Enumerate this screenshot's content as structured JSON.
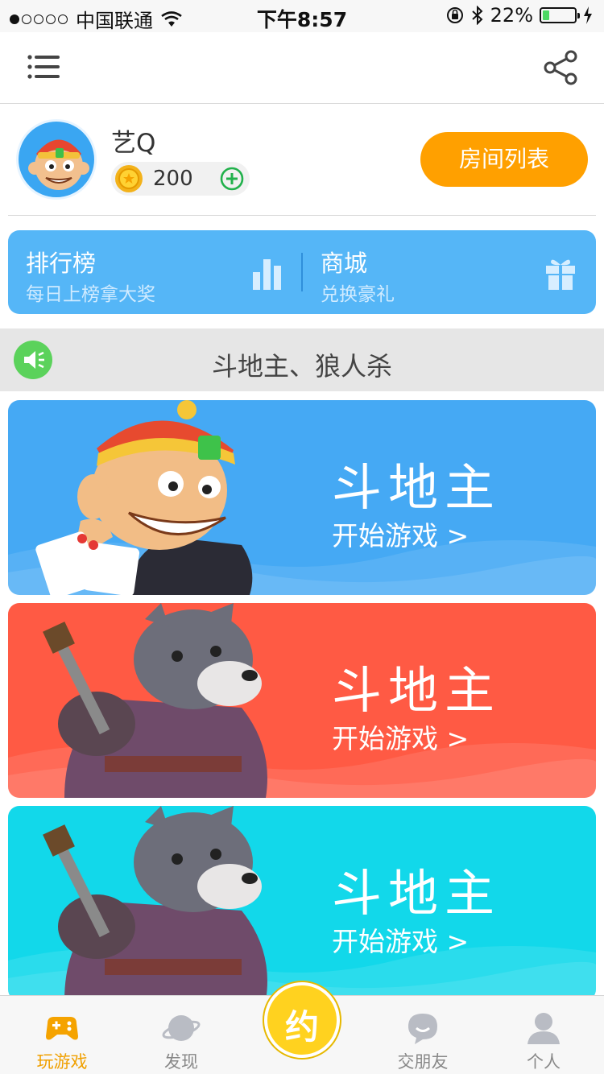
{
  "status_bar": {
    "carrier": "中国联通",
    "time": "下午8:57",
    "battery_percent": "22%",
    "battery_level": 0.22
  },
  "header": {
    "menu_icon": "menu-icon",
    "share_icon": "share-icon"
  },
  "profile": {
    "nickname": "艺Q",
    "coins": "200",
    "room_list_label": "房间列表"
  },
  "panel": {
    "leaderboard_title": "排行榜",
    "leaderboard_sub": "每日上榜拿大奖",
    "shop_title": "商城",
    "shop_sub": "兑换豪礼"
  },
  "notice": {
    "text": "斗地主、狼人杀"
  },
  "cards": [
    {
      "name": "斗地主",
      "cta": "开始游戏 >",
      "color": "#45a9f4"
    },
    {
      "name": "斗地主",
      "cta": "开始游戏 >",
      "color": "#ff5a44"
    },
    {
      "name": "斗地主",
      "cta": "开始游戏 >",
      "color": "#12d8ea"
    }
  ],
  "tabs": [
    {
      "label": "玩游戏",
      "icon": "gamepad-icon",
      "active": true
    },
    {
      "label": "发现",
      "icon": "planet-icon",
      "active": false
    },
    {
      "label": "约",
      "icon": "appointment-icon",
      "active": false
    },
    {
      "label": "交朋友",
      "icon": "chat-bubble-icon",
      "active": false
    },
    {
      "label": "个人",
      "icon": "person-icon",
      "active": false
    }
  ],
  "colors": {
    "accent": "#ffa000",
    "panel": "#55b6f7",
    "tab_active": "#f0a000"
  }
}
